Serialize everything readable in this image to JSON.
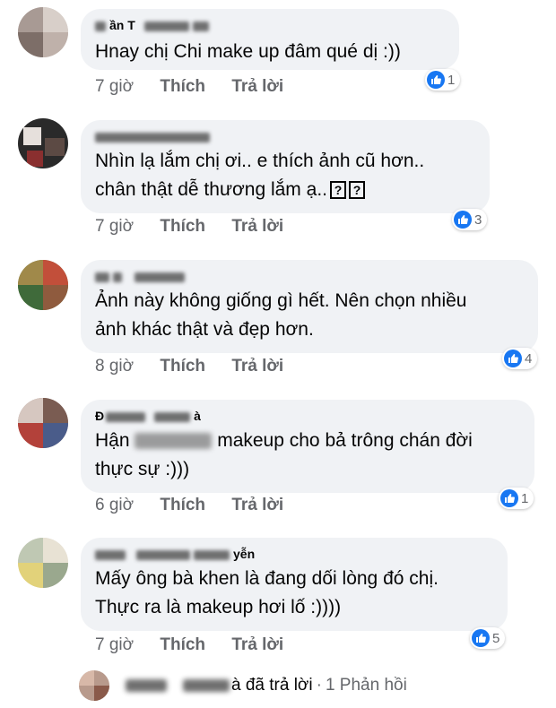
{
  "comments": [
    {
      "author": "ần T",
      "lines": [
        "Hnay chị Chi make up đâm qué dị :))"
      ],
      "time": "7 giờ",
      "like": "Thích",
      "reply": "Trả lời",
      "likes": "1"
    },
    {
      "author": "",
      "lines": [
        "Nhìn lạ lắm chị ơi..  e thích ảnh cũ hơn..",
        "chân thật dễ thương lắm ạ.."
      ],
      "emoji_placeholder": "?",
      "time": "7 giờ",
      "like": "Thích",
      "reply": "Trả lời",
      "likes": "3"
    },
    {
      "author": "",
      "lines": [
        "Ảnh này không giống gì hết. Nên chọn nhiều",
        "ảnh khác thật và đẹp hơn."
      ],
      "time": "8 giờ",
      "like": "Thích",
      "reply": "Trả lời",
      "likes": "4"
    },
    {
      "author": "Đ",
      "author_suffix": "à",
      "line1_prefix": "Hận ",
      "line1_suffix": "makeup cho bả trông chán đời",
      "line2": "thực sự :)))",
      "time": "6 giờ",
      "like": "Thích",
      "reply": "Trả lời",
      "likes": "1"
    },
    {
      "author": "yễn",
      "lines": [
        "Mấy ông bà khen là đang dối lòng đó chị.",
        "Thực ra là makeup hơi lố :))))"
      ],
      "time": "7 giờ",
      "like": "Thích",
      "reply": "Trả lời",
      "likes": "5"
    }
  ],
  "reply_summary": {
    "name_suffix": "à đã trả lời",
    "separator": "·",
    "count": "1 Phản hồi"
  },
  "icons": {
    "like": "thumbs-up-icon"
  },
  "colors": {
    "bubble": "#f0f2f5",
    "like_blue": "#1877f2",
    "meta_gray": "#65676b"
  }
}
